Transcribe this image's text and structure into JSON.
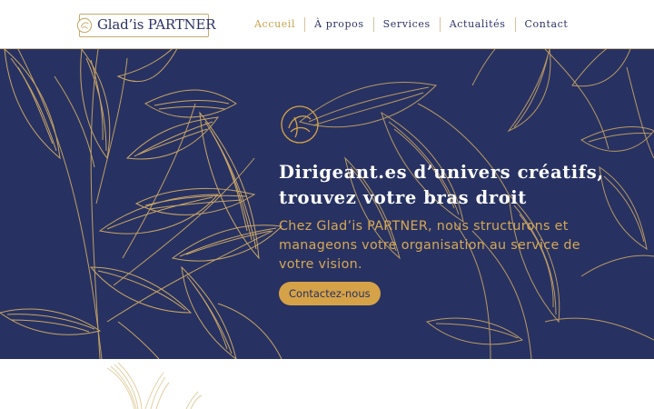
{
  "brand": {
    "name": "Glad’is PARTNER",
    "logo_icon": "monogram-circle-icon"
  },
  "nav": {
    "items": [
      {
        "label": "Accueil",
        "active": true
      },
      {
        "label": "À propos",
        "active": false
      },
      {
        "label": "Services",
        "active": false
      },
      {
        "label": "Actualités",
        "active": false
      },
      {
        "label": "Contact",
        "active": false
      }
    ]
  },
  "hero": {
    "logo_icon": "monogram-circle-icon",
    "title_lines": [
      "Dirigeant.es d’univers créatifs,",
      "trouvez votre bras droit"
    ],
    "text_lines": [
      "Chez Glad’is PARTNER, nous structurons et",
      "manageons votre organisation au service de",
      "votre vision."
    ],
    "cta_label": "Contactez-nous",
    "decoration": "gold-leaves-illustration"
  },
  "colors": {
    "navy": "#273262",
    "gold": "#d6a247",
    "gold_line": "#c9a969",
    "nav_text": "#2b3366",
    "nav_active": "#c9a14a",
    "hero_text": "#d6a756",
    "white": "#ffffff"
  }
}
